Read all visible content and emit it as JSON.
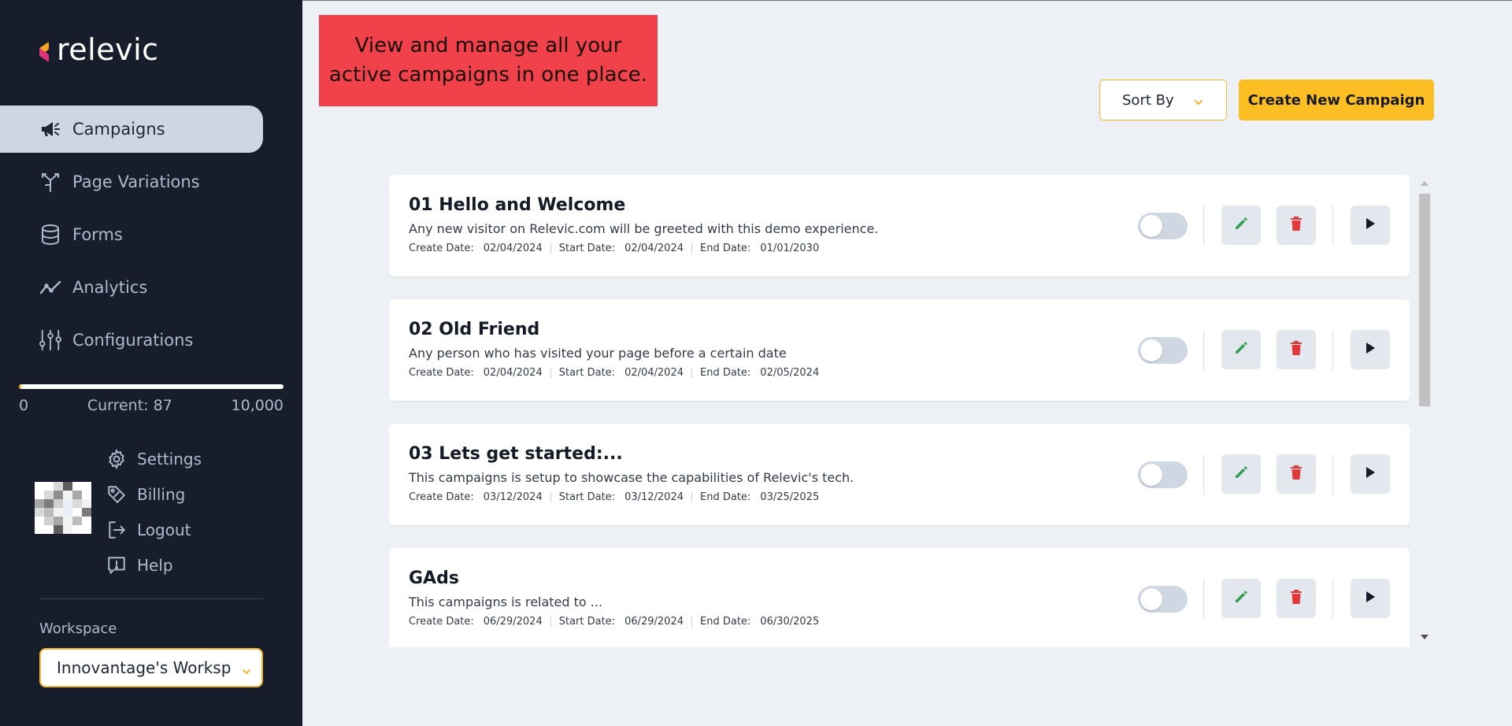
{
  "app": {
    "brand": "relevic",
    "brand_colors": {
      "top": "#f5a623",
      "bottom": "#e0337a"
    }
  },
  "sidebar": {
    "nav": [
      {
        "label": "Campaigns",
        "icon": "megaphone-icon",
        "active": true
      },
      {
        "label": "Page Variations",
        "icon": "split-arrows-icon",
        "active": false
      },
      {
        "label": "Forms",
        "icon": "database-icon",
        "active": false
      },
      {
        "label": "Analytics",
        "icon": "line-chart-icon",
        "active": false
      },
      {
        "label": "Configurations",
        "icon": "sliders-icon",
        "active": false
      }
    ],
    "usage": {
      "min": "0",
      "current_label": "Current: 87",
      "max": "10,000",
      "current": 87,
      "limit": 10000
    },
    "account_menu": [
      {
        "label": "Settings",
        "icon": "gear-icon"
      },
      {
        "label": "Billing",
        "icon": "tag-icon"
      },
      {
        "label": "Logout",
        "icon": "logout-icon"
      },
      {
        "label": "Help",
        "icon": "help-chat-icon"
      }
    ],
    "workspace": {
      "label": "Workspace",
      "selected": "Innovantage's Worksp"
    }
  },
  "main": {
    "banner": "View and manage all your active campaigns in one place.",
    "sort_label": "Sort By",
    "create_label": "Create New Campaign",
    "meta_labels": {
      "create": "Create Date:",
      "start": "Start Date:",
      "end": "End Date:"
    },
    "campaigns": [
      {
        "title": "01 Hello and Welcome",
        "description": "Any new visitor on Relevic.com will be greeted with this demo experience.",
        "create": "02/04/2024",
        "start": "02/04/2024",
        "end": "01/01/2030",
        "enabled": false
      },
      {
        "title": "02 Old Friend",
        "description": "Any person who has visited your page before a certain date",
        "create": "02/04/2024",
        "start": "02/04/2024",
        "end": "02/05/2024",
        "enabled": false
      },
      {
        "title": "03 Lets get started:...",
        "description": "This campaigns is setup to showcase the capabilities of Relevic's tech.",
        "create": "03/12/2024",
        "start": "03/12/2024",
        "end": "03/25/2025",
        "enabled": false
      },
      {
        "title": "GAds",
        "description": "This campaigns is related to ...",
        "create": "06/29/2024",
        "start": "06/29/2024",
        "end": "06/30/2025",
        "enabled": false
      }
    ]
  },
  "colors": {
    "sidebar_bg": "#181d2b",
    "accent": "#fbbf24",
    "banner_bg": "#f1414a",
    "edit_icon": "#2f9e4f",
    "delete_icon": "#e5383b"
  }
}
